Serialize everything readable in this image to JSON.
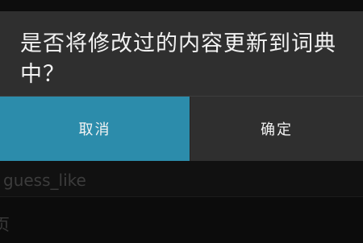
{
  "dialog": {
    "message": "是否将修改过的内容更新到词典中？",
    "cancel_label": "取消",
    "ok_label": "确定"
  },
  "background": {
    "row1_label": "guess_like",
    "row2_label": "页"
  },
  "colors": {
    "accent": "#2c8cab",
    "dialog_bg": "#2f2f2f",
    "screen_bg": "#0d0d0d"
  }
}
